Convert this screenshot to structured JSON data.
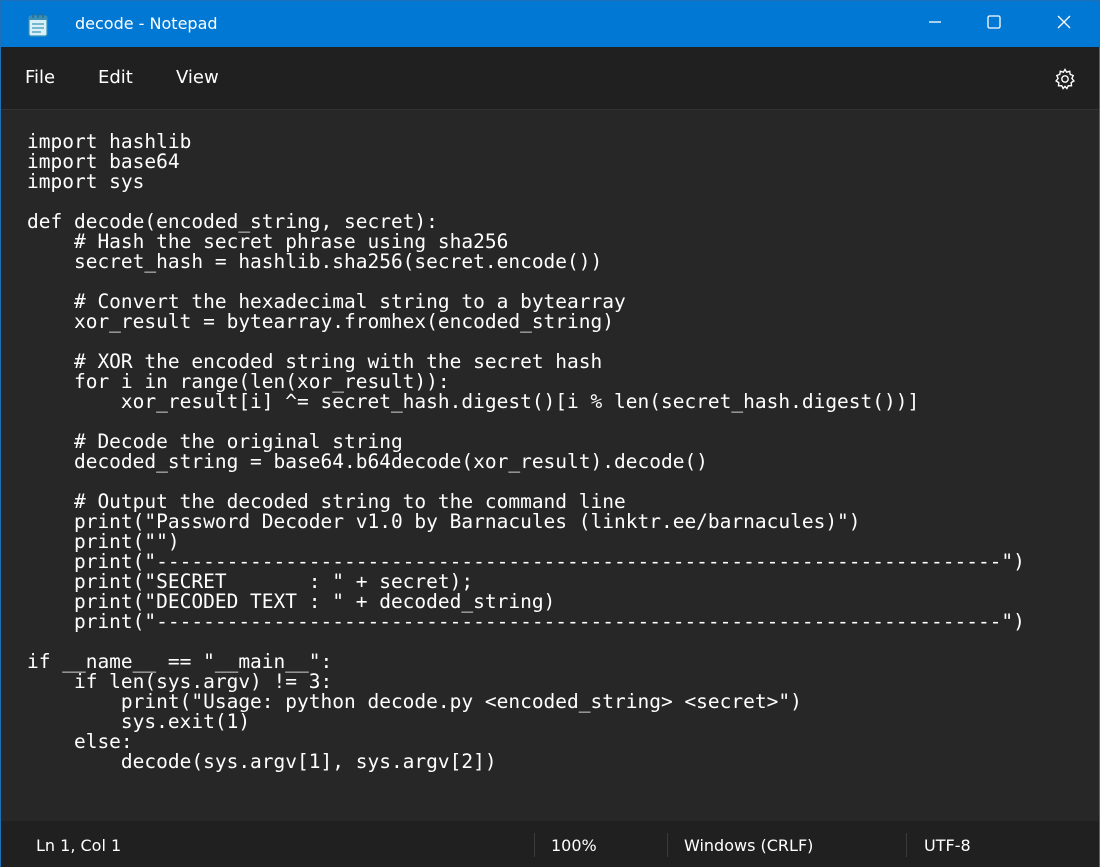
{
  "window": {
    "title": "decode - Notepad",
    "accent_color": "#0078d4"
  },
  "icons": {
    "app": "notepad-icon",
    "minimize": "minimize-icon",
    "maximize": "maximize-icon",
    "close": "close-icon",
    "settings": "gear-icon"
  },
  "menu": {
    "file": "File",
    "edit": "Edit",
    "view": "View"
  },
  "editor": {
    "content": "import hashlib\nimport base64\nimport sys\n\ndef decode(encoded_string, secret):\n    # Hash the secret phrase using sha256\n    secret_hash = hashlib.sha256(secret.encode())\n\n    # Convert the hexadecimal string to a bytearray\n    xor_result = bytearray.fromhex(encoded_string)\n\n    # XOR the encoded string with the secret hash\n    for i in range(len(xor_result)):\n        xor_result[i] ^= secret_hash.digest()[i % len(secret_hash.digest())]\n\n    # Decode the original string\n    decoded_string = base64.b64decode(xor_result).decode()\n\n    # Output the decoded string to the command line\n    print(\"Password Decoder v1.0 by Barnacules (linktr.ee/barnacules)\")\n    print(\"\")\n    print(\"------------------------------------------------------------------------\")\n    print(\"SECRET       : \" + secret);\n    print(\"DECODED TEXT : \" + decoded_string)\n    print(\"------------------------------------------------------------------------\")\n\nif __name__ == \"__main__\":\n    if len(sys.argv) != 3:\n        print(\"Usage: python decode.py <encoded_string> <secret>\")\n        sys.exit(1)\n    else:\n        decode(sys.argv[1], sys.argv[2])"
  },
  "status": {
    "position": "Ln 1, Col 1",
    "zoom": "100%",
    "line_ending": "Windows (CRLF)",
    "encoding": "UTF-8"
  }
}
